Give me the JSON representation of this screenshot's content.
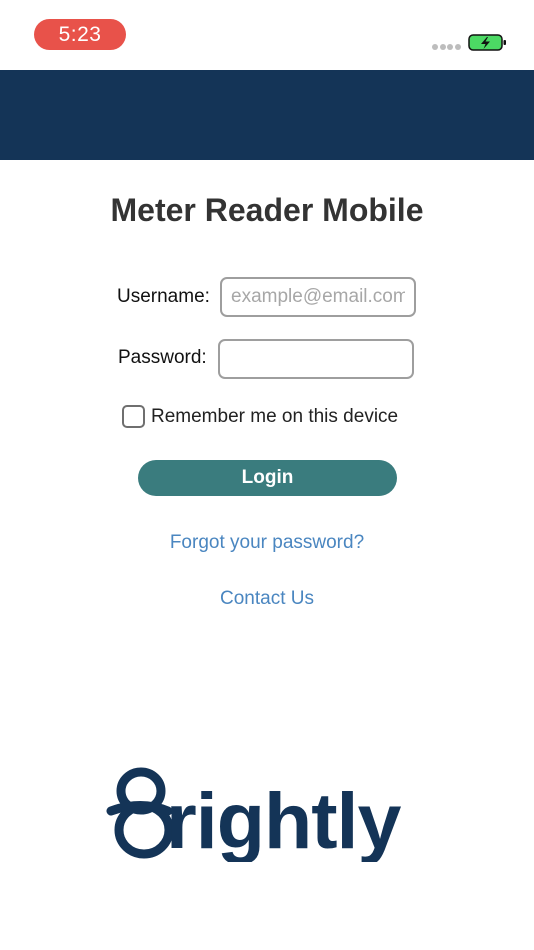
{
  "status_bar": {
    "time": "5:23"
  },
  "login": {
    "title": "Meter Reader Mobile",
    "username_label": "Username:",
    "username_placeholder": "example@email.com",
    "username_value": "",
    "password_label": "Password:",
    "password_value": "",
    "remember_label": "Remember me on this device",
    "remember_checked": false,
    "login_button": "Login",
    "forgot_password_link": "Forgot your password?",
    "contact_link": "Contact Us"
  },
  "brand": {
    "logo_text": "brightly"
  },
  "colors": {
    "header": "#143457",
    "time_pill": "#e8524a",
    "login_button": "#3a7c7e",
    "link": "#4a86c0",
    "logo": "#143457",
    "battery_fill": "#4cd964"
  },
  "icons": [
    "signal-dots-icon",
    "battery-charging-icon",
    "checkbox-icon"
  ]
}
